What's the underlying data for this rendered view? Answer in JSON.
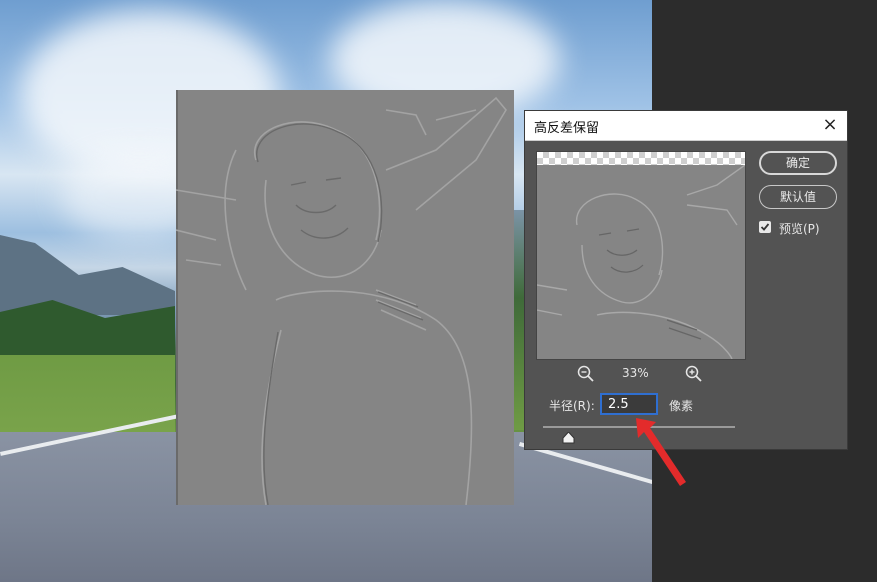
{
  "dialog": {
    "title": "高反差保留",
    "close_icon": "close-icon",
    "buttons": {
      "ok_label": "确定",
      "default_label": "默认值"
    },
    "preview": {
      "label": "预览(P)",
      "checked": true
    },
    "zoom": {
      "value": "33%",
      "zoom_out_icon": "zoom-out-icon",
      "zoom_in_icon": "zoom-in-icon"
    },
    "radius": {
      "label": "半径(R):",
      "value": "2.5",
      "unit": "像素"
    },
    "slider_icon": "slider-thumb-icon"
  },
  "annotation": {
    "arrow_color": "#e32b2b"
  },
  "colors": {
    "accent_input_border": "#2f6fd1",
    "dialog_bg": "#535353",
    "workspace_bg": "#2c2c2c"
  }
}
